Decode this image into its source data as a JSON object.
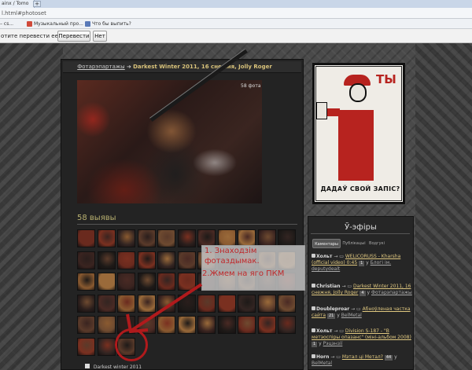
{
  "browser": {
    "tab_title": "ainx / Tomo",
    "new_tab_label": "+",
    "address": "l.html#photoset",
    "bookmarks": [
      {
        "label": "– cs...",
        "color": "#6a8fc8"
      },
      {
        "label": "Музыкальный про...",
        "color": "#d04a3a"
      },
      {
        "label": "Что бы выпить?",
        "color": "#5a7ab8"
      }
    ],
    "translate": {
      "question": "отите перевести ее?",
      "translate_button": "Перевести",
      "no_button": "Нет"
    }
  },
  "page": {
    "breadcrumb_link": "Фотарэпарта­жы",
    "breadcrumb_arrow": "➔",
    "album_title": "Darkest Winter 2011, 16 снежня, Jolly Roger",
    "photo_count": "58 фота",
    "count_heading": "58 выявы",
    "bottom_label": "Darkest winter 2011"
  },
  "instructions": {
    "line1": "1. Знаходзім",
    "line2": "фотаздымак.",
    "line3": "2.Жмем на яго ПКМ"
  },
  "poster": {
    "big_text": "ТЫ",
    "caption": "ДАДАЎ СВОЙ ЗАПІС?"
  },
  "sidebar": {
    "title": "Ў-эфіры",
    "tabs": [
      "Каментары",
      "Публікацыі",
      "Водгукі"
    ],
    "entries": [
      {
        "user": "Хольт",
        "arrow": "→ ▭",
        "topic": "WELICORUSS - Kharsha (official video) 0:45",
        "count": "1",
        "sect": "Блогі ім. deputydealt"
      },
      {
        "user": "Christian",
        "arrow": "→ ▭",
        "topic": "Darkest Winter 2011, 16 снежня, Jolly Roger",
        "count": "4",
        "sect": "Фотарэпартажы"
      },
      {
        "user": "Doubleproar",
        "arrow": "→ ▭",
        "topic": "Абноўленая частка сайта",
        "count": "21",
        "sect": "BelMetal"
      },
      {
        "user": "Хольт",
        "arrow": "→ ▭",
        "topic": "Division S-187 - \"В метэоспіры опазанс\" (міні-альбом 2008)",
        "count": "1",
        "sect": "Рэцэнзії"
      },
      {
        "user": "Horn",
        "arrow": "→ ▭",
        "topic": "Мэтал ці Метал?",
        "count": "44",
        "sect": "BelMetal"
      }
    ]
  },
  "colors": {
    "accent": "#d8c27a",
    "instruction_red": "#c0282a",
    "poster_red": "#b7231f"
  },
  "icons": [
    "heart-icon",
    "arrow-icon",
    "comment-icon"
  ]
}
